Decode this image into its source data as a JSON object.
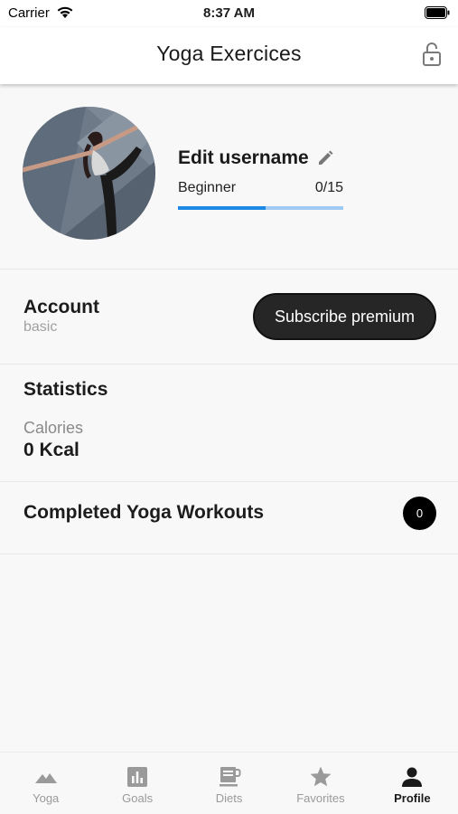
{
  "status_bar": {
    "carrier": "Carrier",
    "time": "8:37 AM"
  },
  "header": {
    "title": "Yoga Exercices",
    "lock_icon": "unlocked-lock-icon"
  },
  "profile": {
    "edit_username_label": "Edit username",
    "level": "Beginner",
    "progress_text": "0/15",
    "progress_fraction": 0.53,
    "avatar": "yoga-pose-photo"
  },
  "account": {
    "title": "Account",
    "type": "basic",
    "subscribe_label": "Subscribe premium"
  },
  "statistics": {
    "title": "Statistics",
    "calories_label": "Calories",
    "calories_value": "0 Kcal"
  },
  "workouts": {
    "label": "Completed Yoga Workouts",
    "count": "0"
  },
  "tabs": [
    {
      "label": "Yoga",
      "icon": "mountain-icon",
      "active": false
    },
    {
      "label": "Goals",
      "icon": "bar-chart-icon",
      "active": false
    },
    {
      "label": "Diets",
      "icon": "coffee-cup-icon",
      "active": false
    },
    {
      "label": "Favorites",
      "icon": "star-icon",
      "active": false
    },
    {
      "label": "Profile",
      "icon": "person-icon",
      "active": true
    }
  ],
  "colors": {
    "accent": "#1e88e5",
    "accent_light": "#9fcaf3",
    "button": "#262626",
    "inactive_tab": "#9a9a9a"
  }
}
